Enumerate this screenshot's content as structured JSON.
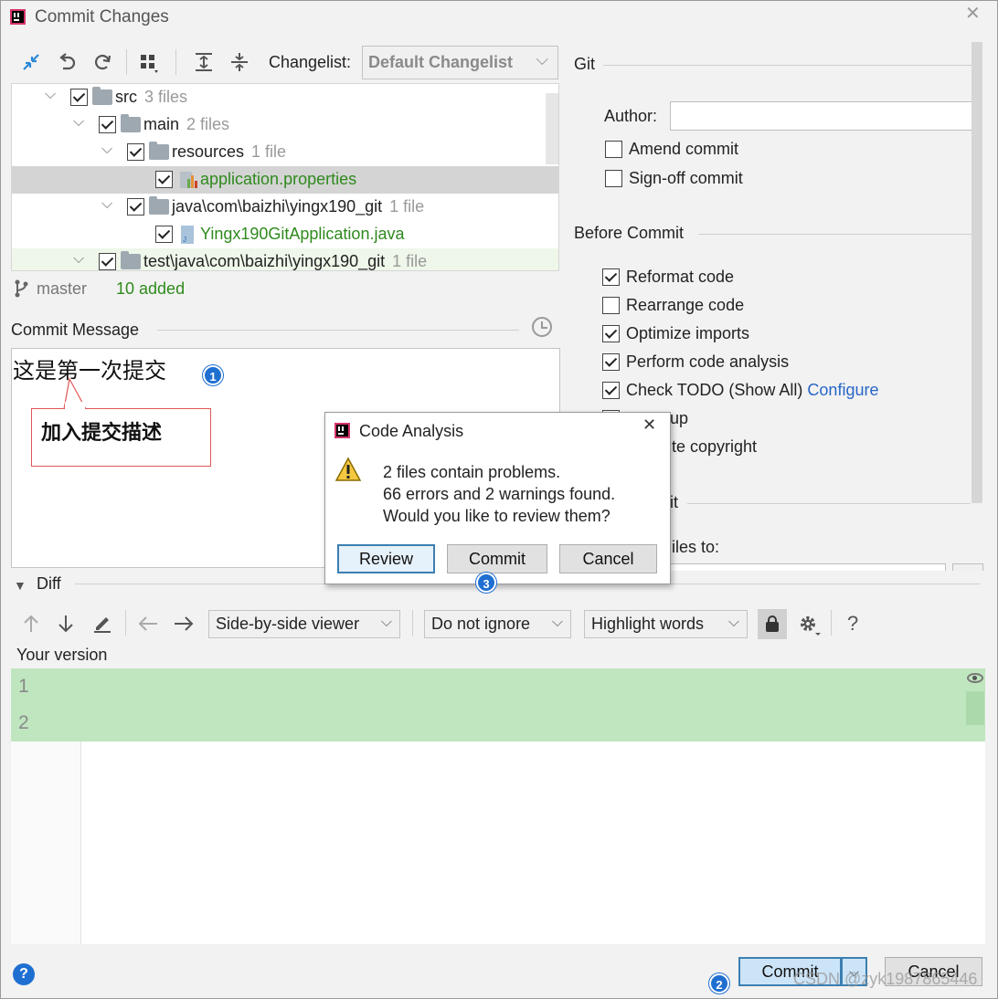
{
  "window": {
    "title": "Commit Changes"
  },
  "toolbar": {
    "changelist_label": "Changelist:",
    "changelist_value": "Default Changelist",
    "icons": [
      "move-icon",
      "undo-icon",
      "refresh-icon",
      "group-by-icon",
      "expand-all-icon",
      "collapse-all-icon"
    ]
  },
  "tree": {
    "rows": [
      {
        "name": "src",
        "meta": "3 files"
      },
      {
        "name": "main",
        "meta": "2 files"
      },
      {
        "name": "resources",
        "meta": "1 file"
      },
      {
        "name": "application.properties",
        "meta": ""
      },
      {
        "name": "java\\com\\baizhi\\yingx190_git",
        "meta": "1 file"
      },
      {
        "name": "Yingx190GitApplication.java",
        "meta": ""
      },
      {
        "name": "test\\java\\com\\baizhi\\yingx190_git",
        "meta": "1 file"
      }
    ]
  },
  "status": {
    "branch": "master",
    "added": "10 added"
  },
  "commit_message": {
    "label": "Commit Message",
    "text": "这是第一次提交",
    "callout": "加入提交描述"
  },
  "badges": {
    "one": "1",
    "two": "2",
    "three": "3"
  },
  "git": {
    "section": "Git",
    "author_label": "Author:",
    "author_value": "",
    "amend": "Amend commit",
    "signoff": "Sign-off commit"
  },
  "before_commit": {
    "section": "Before Commit",
    "reformat": "Reformat code",
    "rearrange": "Rearrange code",
    "optimize": "Optimize imports",
    "analysis": "Perform code analysis",
    "todo": "Check TODO (Show All)",
    "configure": "Configure",
    "cleanup_partial": "up",
    "copyright_partial": "te copyright"
  },
  "after_commit": {
    "section_partial": "it",
    "files_to_partial": "iles to:"
  },
  "diff": {
    "label": "Diff",
    "viewer": "Side-by-side viewer",
    "ignore": "Do not ignore",
    "highlight": "Highlight words",
    "your_version": "Your version",
    "line_numbers": [
      "1",
      "2"
    ]
  },
  "footer": {
    "help": "?",
    "commit": "Commit",
    "cancel": "Cancel",
    "watermark": "CSDN @zyk1987865446"
  },
  "dialog": {
    "title": "Code Analysis",
    "line1": "2 files contain problems.",
    "line2": "66 errors and 2 warnings found.",
    "line3": "Would you like to review them?",
    "review": "Review",
    "commit": "Commit",
    "cancel": "Cancel"
  }
}
